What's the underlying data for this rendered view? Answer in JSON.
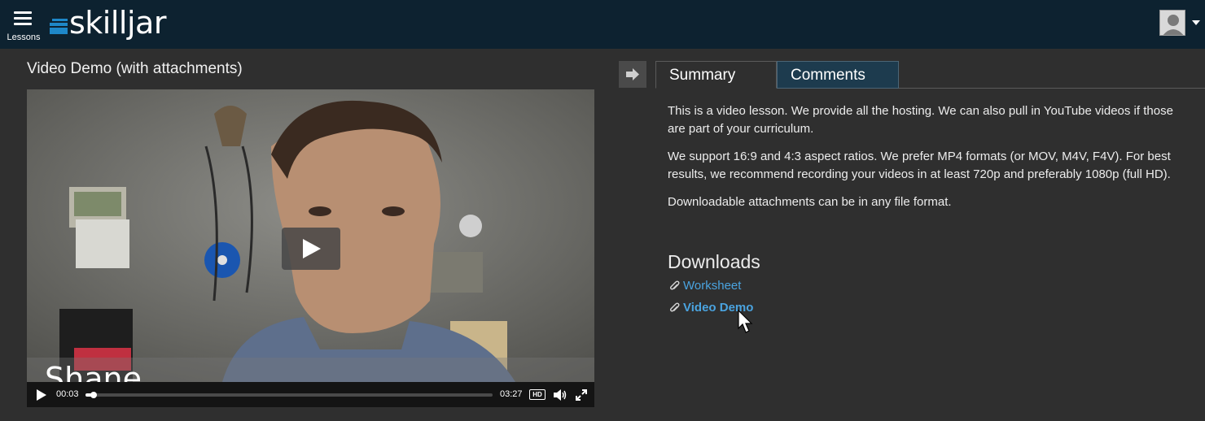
{
  "nav": {
    "lessons_label": "Lessons",
    "logo_text": "skilljar"
  },
  "lesson": {
    "title": "Video Demo (with attachments)"
  },
  "video": {
    "caption_overlay": "Shane",
    "current_time": "00:03",
    "duration": "03:27",
    "progress_fraction": 0.015,
    "hd_label": "HD"
  },
  "tabs": [
    {
      "label": "Summary",
      "active": true
    },
    {
      "label": "Comments",
      "active": false
    }
  ],
  "summary": {
    "paragraphs": [
      "This is a video lesson. We provide all the hosting. We can also pull in YouTube videos if those are part of your curriculum.",
      "We support 16:9 and 4:3 aspect ratios. We prefer MP4 formats (or MOV, M4V, F4V). For best results, we recommend recording your videos in at least 720p and preferably 1080p (full HD).",
      "Downloadable attachments can be in any file format."
    ]
  },
  "downloads": {
    "title": "Downloads",
    "items": [
      {
        "label": "Worksheet",
        "icon": "paperclip-icon"
      },
      {
        "label": "Video Demo",
        "icon": "paperclip-icon"
      }
    ]
  },
  "colors": {
    "topbar": "#0d2230",
    "background": "#2f2f2f",
    "link": "#4aa3df",
    "tab_inactive": "#1d3b4e"
  }
}
